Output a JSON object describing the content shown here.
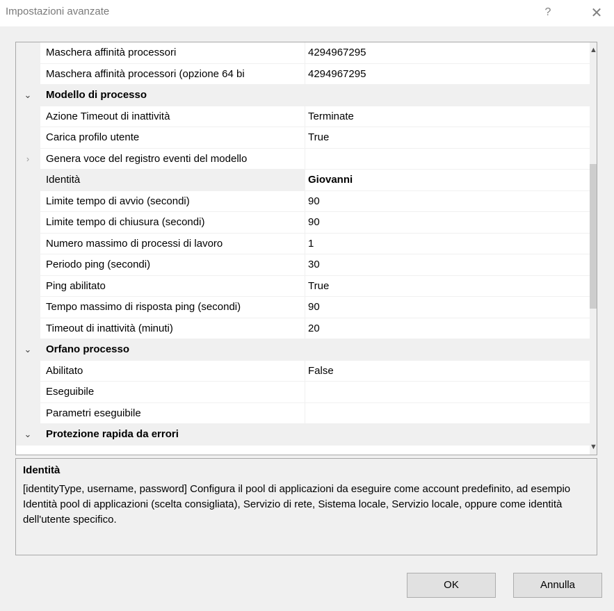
{
  "window": {
    "title": "Impostazioni avanzate",
    "help_label": "?",
    "close_label": "✕"
  },
  "grid": {
    "rows": [
      {
        "type": "prop",
        "name": "Maschera affinità processori",
        "value": "4294967295"
      },
      {
        "type": "prop",
        "name": "Maschera affinità processori (opzione 64 bi",
        "value": "4294967295"
      },
      {
        "type": "category",
        "name": "Modello di processo",
        "chevron": "⌄"
      },
      {
        "type": "prop",
        "name": "Azione Timeout di inattività",
        "value": "Terminate"
      },
      {
        "type": "prop",
        "name": "Carica profilo utente",
        "value": "True"
      },
      {
        "type": "expandable",
        "name": "Genera voce del registro eventi del modello",
        "value": "",
        "chevron": "›"
      },
      {
        "type": "prop",
        "name": "Identità",
        "value": "Giovanni",
        "selected": true,
        "bold": true
      },
      {
        "type": "prop",
        "name": "Limite tempo di avvio (secondi)",
        "value": "90"
      },
      {
        "type": "prop",
        "name": "Limite tempo di chiusura (secondi)",
        "value": "90"
      },
      {
        "type": "prop",
        "name": "Numero massimo di processi di lavoro",
        "value": "1"
      },
      {
        "type": "prop",
        "name": "Periodo ping (secondi)",
        "value": "30"
      },
      {
        "type": "prop",
        "name": "Ping abilitato",
        "value": "True"
      },
      {
        "type": "prop",
        "name": "Tempo massimo di risposta ping (secondi)",
        "value": "90"
      },
      {
        "type": "prop",
        "name": "Timeout di inattività (minuti)",
        "value": "20"
      },
      {
        "type": "category",
        "name": "Orfano processo",
        "chevron": "⌄"
      },
      {
        "type": "prop",
        "name": "Abilitato",
        "value": "False"
      },
      {
        "type": "prop",
        "name": "Eseguibile",
        "value": ""
      },
      {
        "type": "prop",
        "name": "Parametri eseguibile",
        "value": ""
      },
      {
        "type": "category",
        "name": "Protezione rapida da errori",
        "chevron": "⌄"
      }
    ],
    "scroll_up_icon": "▲",
    "scroll_down_icon": "▼"
  },
  "description": {
    "title": "Identità",
    "text": "[identityType, username, password] Configura il pool di applicazioni da eseguire come account predefinito, ad esempio Identità pool di applicazioni (scelta consigliata), Servizio di rete, Sistema locale, Servizio locale, oppure come identità dell'utente specifico."
  },
  "buttons": {
    "ok_label": "OK",
    "cancel_label": "Annulla"
  }
}
